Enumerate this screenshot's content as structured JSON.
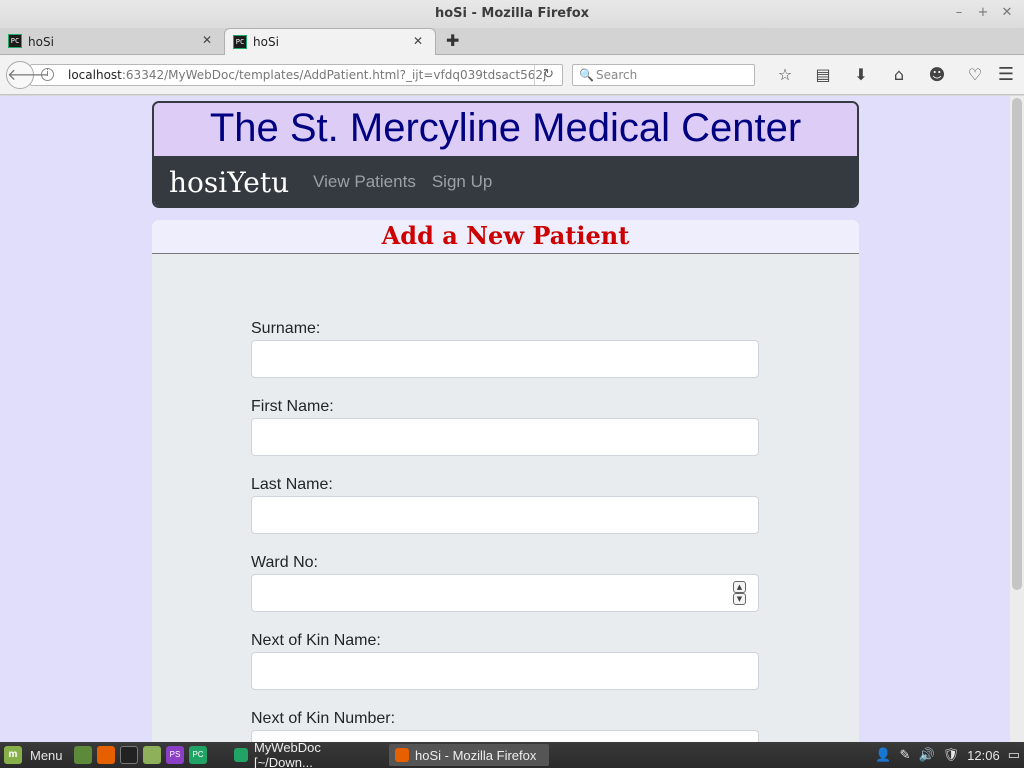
{
  "window": {
    "title": "hoSi - Mozilla Firefox",
    "controls": [
      "–",
      "+",
      "✕"
    ]
  },
  "tabs": [
    {
      "label": "hoSi",
      "icon": "pycharm-icon",
      "active": false
    },
    {
      "label": "hoSi",
      "icon": "pycharm-icon",
      "active": true
    }
  ],
  "icons": {
    "pycharm_text": "PC",
    "close": "✕",
    "new_tab": "✚",
    "back": "🡐",
    "info": "i",
    "reload": "↻",
    "search": "🔍",
    "bookmark_star": "☆",
    "reading_list": "▤",
    "download": "⬇",
    "home": "⌂",
    "chat": "☻",
    "pocket": "♡",
    "menu": "☰",
    "spin_up": "▲",
    "spin_down": "▼"
  },
  "urlbar": {
    "host": "localhost",
    "rest": ":63342/MyWebDoc/templates/AddPatient.html?_ijt=vfdq039tdsact562j"
  },
  "search": {
    "placeholder": "Search"
  },
  "site": {
    "title": "The St. Mercyline Medical Center",
    "brand": "hosiYetu",
    "nav": [
      "View Patients",
      "Sign Up"
    ]
  },
  "form": {
    "heading": "Add a New Patient",
    "fields": [
      {
        "label": "Surname:",
        "value": ""
      },
      {
        "label": "First Name:",
        "value": ""
      },
      {
        "label": "Last Name:",
        "value": ""
      },
      {
        "label": "Ward No:",
        "value": ""
      },
      {
        "label": "Next of Kin Name:",
        "value": ""
      },
      {
        "label": "Next of Kin Number:",
        "value": ""
      }
    ]
  },
  "taskbar": {
    "menu_label": "Menu",
    "mint_text": "m",
    "launcher_labels": [
      "PS",
      "PC"
    ],
    "windows": [
      {
        "label": "MyWebDoc [~/Down...",
        "active": false
      },
      {
        "label": "hoSi - Mozilla Firefox",
        "active": true
      }
    ],
    "clock": "12:06",
    "tray_icons": {
      "user": "👤",
      "network": "✎",
      "volume": "🔊",
      "shield": "🛡",
      "display": "▭"
    }
  },
  "colors": {
    "page_bg": "#e0defa",
    "title_bg": "#ddccf6",
    "title_text": "#000080",
    "nav_bg": "#343a40",
    "heading_text": "#cc0000"
  }
}
